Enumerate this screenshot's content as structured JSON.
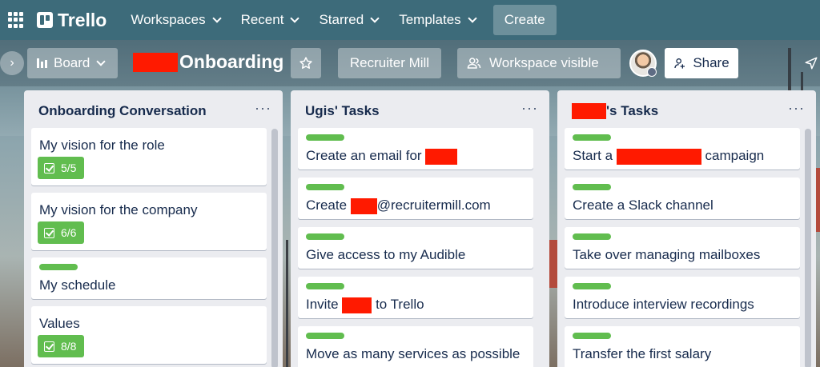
{
  "nav": {
    "logo": "Trello",
    "items": [
      {
        "label": "Workspaces"
      },
      {
        "label": "Recent"
      },
      {
        "label": "Starred"
      },
      {
        "label": "Templates"
      }
    ],
    "create_label": "Create"
  },
  "board": {
    "view_label": "Board",
    "title": "Onboarding",
    "workspace_name": "Recruiter Mill",
    "visibility_label": "Workspace visible",
    "share_label": "Share"
  },
  "lists": [
    {
      "title": "Onboarding Conversation",
      "cards": [
        {
          "text": "My vision for the role",
          "checklist": "5/5"
        },
        {
          "text": "My vision for the company",
          "checklist": "6/6"
        },
        {
          "text": "My schedule"
        },
        {
          "text": "Values",
          "checklist": "8/8"
        }
      ]
    },
    {
      "title": "Ugis' Tasks",
      "cards": [
        {
          "text_before": "Create an email for ",
          "text_after": ""
        },
        {
          "text_before": "Create ",
          "text_after": "@recruitermill.com"
        },
        {
          "text": "Give access to my Audible"
        },
        {
          "text_before": "Invite ",
          "text_after": " to Trello"
        },
        {
          "text": "Move as many services as possible"
        }
      ]
    },
    {
      "title_suffix": "'s Tasks",
      "cards": [
        {
          "text_before": "Start a ",
          "text_after": " campaign"
        },
        {
          "text": "Create a Slack channel"
        },
        {
          "text": "Take over managing mailboxes"
        },
        {
          "text": "Introduce interview recordings"
        },
        {
          "text": "Transfer the first salary"
        }
      ]
    }
  ],
  "list_menu": "···",
  "colors": {
    "nav_bg": "#3d6b7a",
    "label_green": "#61bd4f",
    "redaction": "#ff1a00",
    "list_bg": "#ebecf0"
  }
}
